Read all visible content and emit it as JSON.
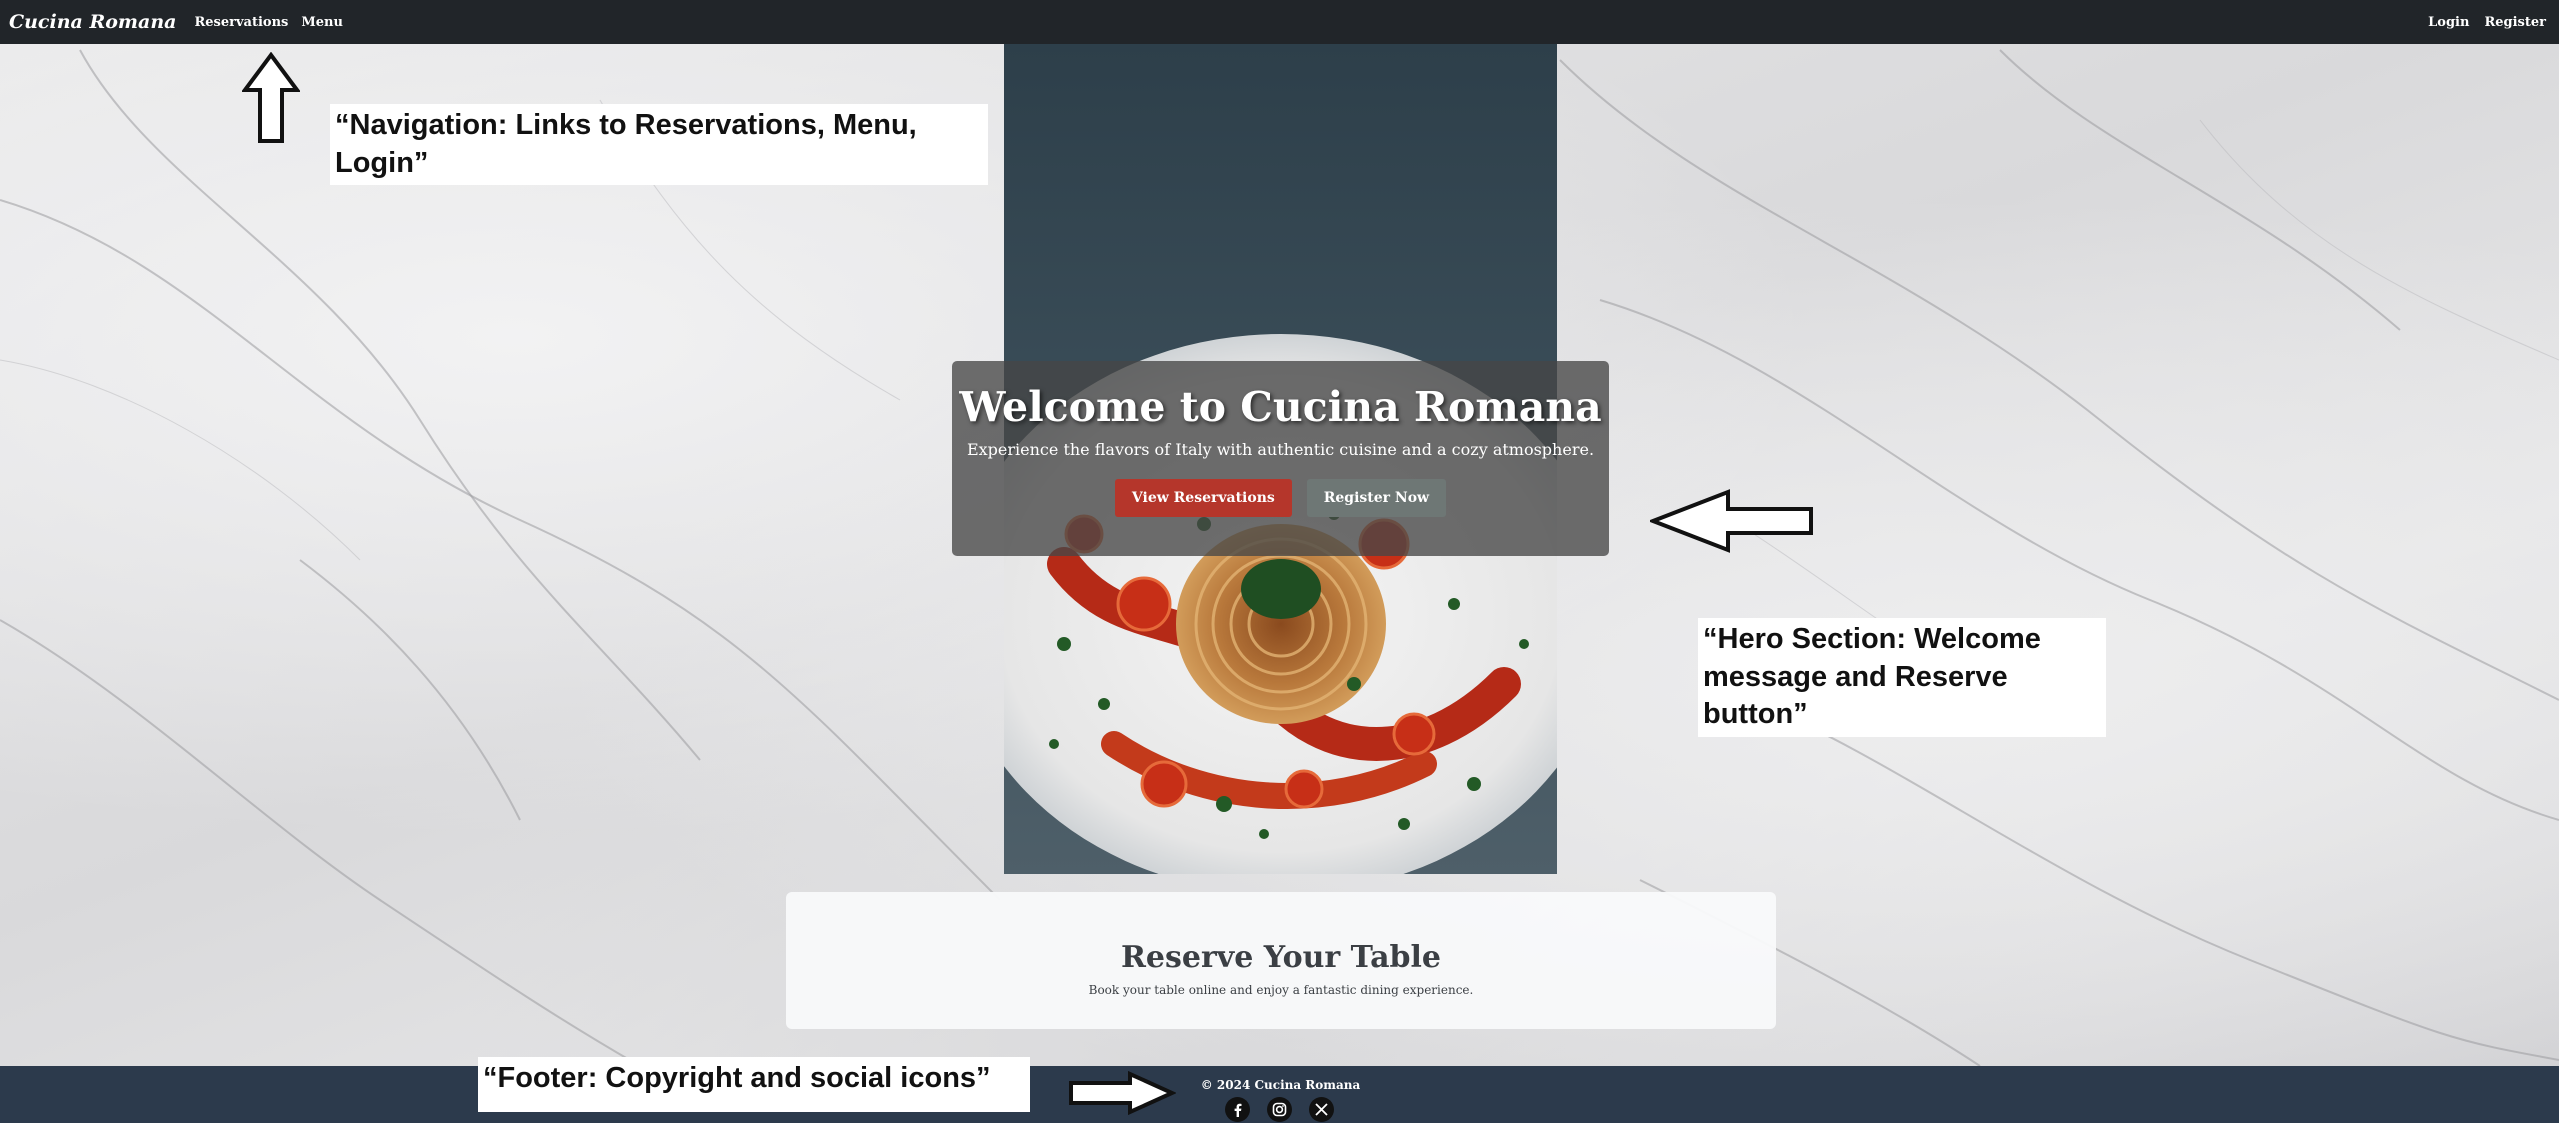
{
  "navbar": {
    "brand": "Cucina Romana",
    "links_left": [
      "Reservations",
      "Menu"
    ],
    "links_right": [
      "Login",
      "Register"
    ]
  },
  "hero": {
    "title": "Welcome to Cucina Romana",
    "subtitle": "Experience the flavors of Italy with authentic cuisine and a cozy atmosphere.",
    "primary_button": "View Reservations",
    "secondary_button": "Register Now"
  },
  "reserve": {
    "title": "Reserve Your Table",
    "text": "Book your table online and enjoy a fantastic dining experience."
  },
  "footer": {
    "copyright": "© 2024 Cucina Romana",
    "social_icons": [
      "facebook-icon",
      "instagram-icon",
      "x-icon"
    ]
  },
  "annotations": {
    "nav": "“Navigation: Links to Reservations, Menu, Login”",
    "hero_line1": "“Hero Section: Welcome",
    "hero_line2": "message and Reserve button”",
    "footer": "“Footer: Copyright and social icons”"
  },
  "colors": {
    "navbar_bg": "#212529",
    "footer_bg": "#2c3a4c",
    "primary_button": "#b5362b",
    "secondary_button": "#6e7775"
  }
}
